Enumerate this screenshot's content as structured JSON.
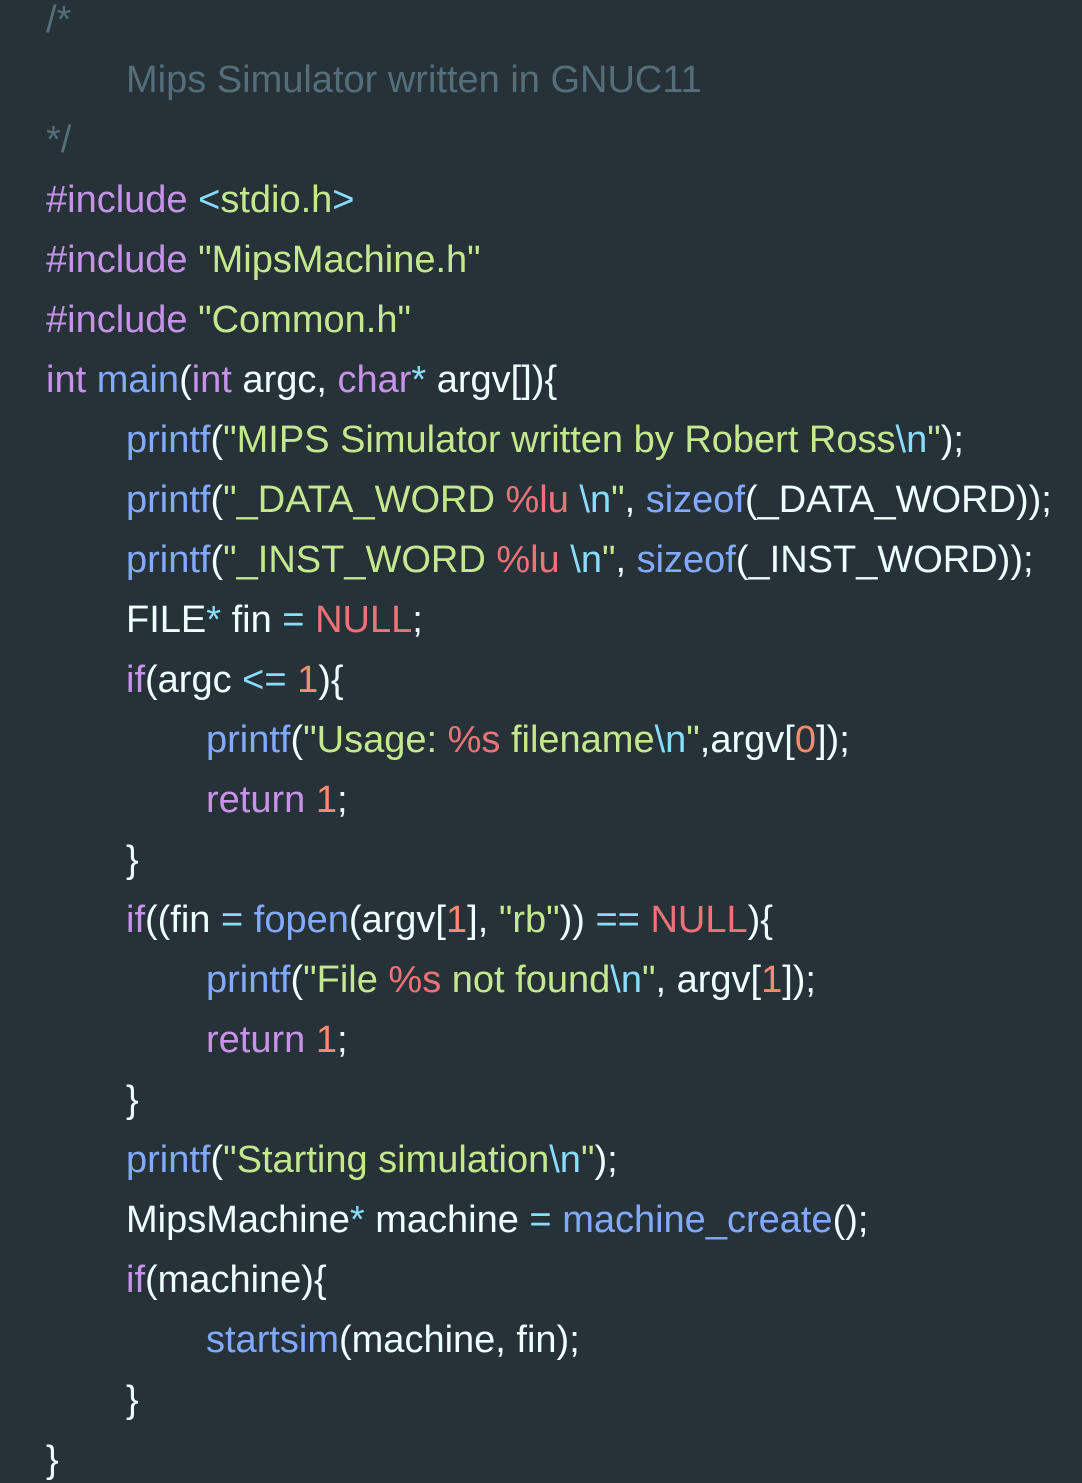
{
  "theme": {
    "background": "#263238",
    "text": "#eeffff",
    "comment": "#546e7a",
    "keyword": "#c792ea",
    "function": "#82aaff",
    "string": "#c3e88d",
    "escape": "#89ddff",
    "format": "#f07178",
    "number": "#f78c6c",
    "constant": "#f07178"
  },
  "code": {
    "lines": [
      {
        "indent": 0,
        "tokens": [
          {
            "t": "comment",
            "v": "/*"
          }
        ]
      },
      {
        "indent": 1,
        "tokens": [
          {
            "t": "comment",
            "v": "Mips Simulator written in GNUC11"
          }
        ]
      },
      {
        "indent": 0,
        "tokens": [
          {
            "t": "comment",
            "v": "*/"
          }
        ]
      },
      {
        "indent": 0,
        "tokens": [
          {
            "t": "keyword",
            "v": "#include"
          },
          {
            "t": "plain",
            "v": " "
          },
          {
            "t": "escape",
            "v": "<"
          },
          {
            "t": "string",
            "v": "stdio.h"
          },
          {
            "t": "escape",
            "v": ">"
          }
        ]
      },
      {
        "indent": 0,
        "tokens": [
          {
            "t": "keyword",
            "v": "#include"
          },
          {
            "t": "plain",
            "v": " "
          },
          {
            "t": "string",
            "v": "\"MipsMachine.h\""
          }
        ]
      },
      {
        "indent": 0,
        "tokens": [
          {
            "t": "keyword",
            "v": "#include"
          },
          {
            "t": "plain",
            "v": " "
          },
          {
            "t": "string",
            "v": "\"Common.h\""
          }
        ]
      },
      {
        "indent": 0,
        "tokens": [
          {
            "t": "keyword",
            "v": "int"
          },
          {
            "t": "plain",
            "v": " "
          },
          {
            "t": "func",
            "v": "main"
          },
          {
            "t": "plain",
            "v": "("
          },
          {
            "t": "keyword",
            "v": "int"
          },
          {
            "t": "plain",
            "v": " argc, "
          },
          {
            "t": "keyword",
            "v": "char"
          },
          {
            "t": "op",
            "v": "*"
          },
          {
            "t": "plain",
            "v": " argv[]){"
          }
        ]
      },
      {
        "indent": 1,
        "tokens": [
          {
            "t": "func",
            "v": "printf"
          },
          {
            "t": "plain",
            "v": "("
          },
          {
            "t": "string",
            "v": "\"MIPS Simulator written by Robert Ross"
          },
          {
            "t": "escape",
            "v": "\\n"
          },
          {
            "t": "string",
            "v": "\""
          },
          {
            "t": "plain",
            "v": ");"
          }
        ]
      },
      {
        "indent": 1,
        "tokens": [
          {
            "t": "func",
            "v": "printf"
          },
          {
            "t": "plain",
            "v": "("
          },
          {
            "t": "string",
            "v": "\"_DATA_WORD "
          },
          {
            "t": "format",
            "v": "%lu"
          },
          {
            "t": "string",
            "v": " "
          },
          {
            "t": "escape",
            "v": "\\n"
          },
          {
            "t": "string",
            "v": "\""
          },
          {
            "t": "plain",
            "v": ", "
          },
          {
            "t": "func",
            "v": "sizeof"
          },
          {
            "t": "plain",
            "v": "(_DATA_WORD));"
          }
        ]
      },
      {
        "indent": 1,
        "tokens": [
          {
            "t": "func",
            "v": "printf"
          },
          {
            "t": "plain",
            "v": "("
          },
          {
            "t": "string",
            "v": "\"_INST_WORD "
          },
          {
            "t": "format",
            "v": "%lu"
          },
          {
            "t": "string",
            "v": " "
          },
          {
            "t": "escape",
            "v": "\\n"
          },
          {
            "t": "string",
            "v": "\""
          },
          {
            "t": "plain",
            "v": ", "
          },
          {
            "t": "func",
            "v": "sizeof"
          },
          {
            "t": "plain",
            "v": "(_INST_WORD));"
          }
        ]
      },
      {
        "indent": 1,
        "tokens": [
          {
            "t": "plain",
            "v": "FILE"
          },
          {
            "t": "op",
            "v": "*"
          },
          {
            "t": "plain",
            "v": " fin "
          },
          {
            "t": "op",
            "v": "="
          },
          {
            "t": "plain",
            "v": " "
          },
          {
            "t": "const",
            "v": "NULL"
          },
          {
            "t": "plain",
            "v": ";"
          }
        ]
      },
      {
        "indent": 1,
        "tokens": [
          {
            "t": "keyword",
            "v": "if"
          },
          {
            "t": "plain",
            "v": "(argc "
          },
          {
            "t": "op",
            "v": "<="
          },
          {
            "t": "plain",
            "v": " "
          },
          {
            "t": "number",
            "v": "1"
          },
          {
            "t": "plain",
            "v": "){"
          }
        ]
      },
      {
        "indent": 2,
        "tokens": [
          {
            "t": "func",
            "v": "printf"
          },
          {
            "t": "plain",
            "v": "("
          },
          {
            "t": "string",
            "v": "\"Usage: "
          },
          {
            "t": "format",
            "v": "%s"
          },
          {
            "t": "string",
            "v": " filename"
          },
          {
            "t": "escape",
            "v": "\\n"
          },
          {
            "t": "string",
            "v": "\""
          },
          {
            "t": "plain",
            "v": ",argv["
          },
          {
            "t": "number",
            "v": "0"
          },
          {
            "t": "plain",
            "v": "]);"
          }
        ]
      },
      {
        "indent": 2,
        "tokens": [
          {
            "t": "keyword",
            "v": "return"
          },
          {
            "t": "plain",
            "v": " "
          },
          {
            "t": "number",
            "v": "1"
          },
          {
            "t": "plain",
            "v": ";"
          }
        ]
      },
      {
        "indent": 1,
        "tokens": [
          {
            "t": "plain",
            "v": "}"
          }
        ]
      },
      {
        "indent": 1,
        "tokens": [
          {
            "t": "keyword",
            "v": "if"
          },
          {
            "t": "plain",
            "v": "((fin "
          },
          {
            "t": "op",
            "v": "="
          },
          {
            "t": "plain",
            "v": " "
          },
          {
            "t": "func",
            "v": "fopen"
          },
          {
            "t": "plain",
            "v": "(argv["
          },
          {
            "t": "number",
            "v": "1"
          },
          {
            "t": "plain",
            "v": "], "
          },
          {
            "t": "string",
            "v": "\"rb\""
          },
          {
            "t": "plain",
            "v": ")) "
          },
          {
            "t": "op",
            "v": "=="
          },
          {
            "t": "plain",
            "v": " "
          },
          {
            "t": "const",
            "v": "NULL"
          },
          {
            "t": "plain",
            "v": "){"
          }
        ]
      },
      {
        "indent": 2,
        "tokens": [
          {
            "t": "func",
            "v": "printf"
          },
          {
            "t": "plain",
            "v": "("
          },
          {
            "t": "string",
            "v": "\"File "
          },
          {
            "t": "format",
            "v": "%s"
          },
          {
            "t": "string",
            "v": " not found"
          },
          {
            "t": "escape",
            "v": "\\n"
          },
          {
            "t": "string",
            "v": "\""
          },
          {
            "t": "plain",
            "v": ", argv["
          },
          {
            "t": "number",
            "v": "1"
          },
          {
            "t": "plain",
            "v": "]);"
          }
        ]
      },
      {
        "indent": 2,
        "tokens": [
          {
            "t": "keyword",
            "v": "return"
          },
          {
            "t": "plain",
            "v": " "
          },
          {
            "t": "number",
            "v": "1"
          },
          {
            "t": "plain",
            "v": ";"
          }
        ]
      },
      {
        "indent": 1,
        "tokens": [
          {
            "t": "plain",
            "v": "}"
          }
        ]
      },
      {
        "indent": 1,
        "tokens": [
          {
            "t": "func",
            "v": "printf"
          },
          {
            "t": "plain",
            "v": "("
          },
          {
            "t": "string",
            "v": "\"Starting simulation"
          },
          {
            "t": "escape",
            "v": "\\n"
          },
          {
            "t": "string",
            "v": "\""
          },
          {
            "t": "plain",
            "v": ");"
          }
        ]
      },
      {
        "indent": 1,
        "tokens": [
          {
            "t": "plain",
            "v": "MipsMachine"
          },
          {
            "t": "op",
            "v": "*"
          },
          {
            "t": "plain",
            "v": " machine "
          },
          {
            "t": "op",
            "v": "="
          },
          {
            "t": "plain",
            "v": " "
          },
          {
            "t": "func",
            "v": "machine_create"
          },
          {
            "t": "plain",
            "v": "();"
          }
        ]
      },
      {
        "indent": 1,
        "tokens": [
          {
            "t": "keyword",
            "v": "if"
          },
          {
            "t": "plain",
            "v": "(machine){"
          }
        ]
      },
      {
        "indent": 2,
        "tokens": [
          {
            "t": "func",
            "v": "startsim"
          },
          {
            "t": "plain",
            "v": "(machine, fin);"
          }
        ]
      },
      {
        "indent": 1,
        "tokens": [
          {
            "t": "plain",
            "v": "}"
          }
        ]
      },
      {
        "indent": 0,
        "tokens": [
          {
            "t": "plain",
            "v": "}"
          }
        ]
      }
    ]
  }
}
